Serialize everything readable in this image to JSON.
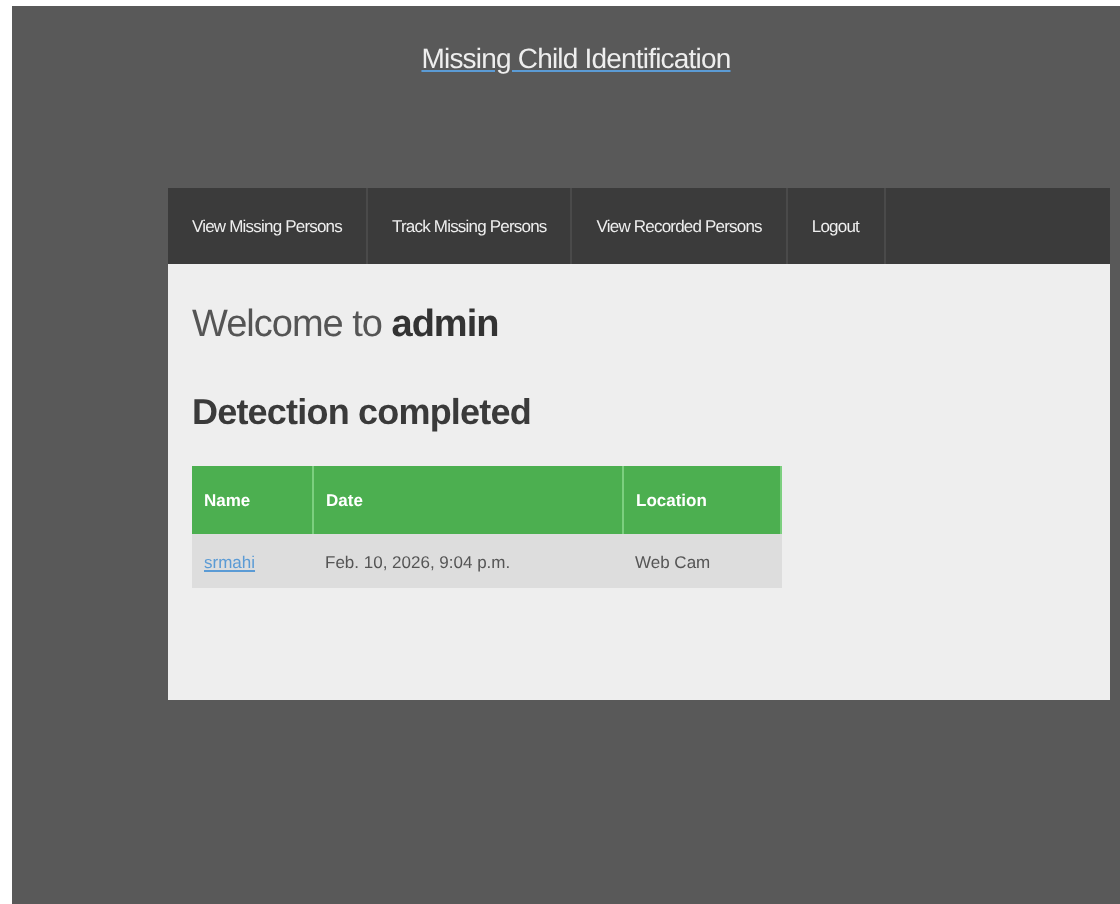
{
  "site_title": "Missing Child Identification",
  "nav": [
    {
      "label": "View Missing Persons"
    },
    {
      "label": "Track Missing Persons"
    },
    {
      "label": "View Recorded Persons"
    },
    {
      "label": "Logout"
    }
  ],
  "welcome": "Welcome to **admin**",
  "heading": "Detection completed",
  "table": {
    "columns": [
      "Name",
      "Date",
      "Location"
    ],
    "rows": [
      [
        "srmahi",
        "Feb. 10, 2026, 9:04 p.m.",
        "Web Cam"
      ]
    ]
  }
}
